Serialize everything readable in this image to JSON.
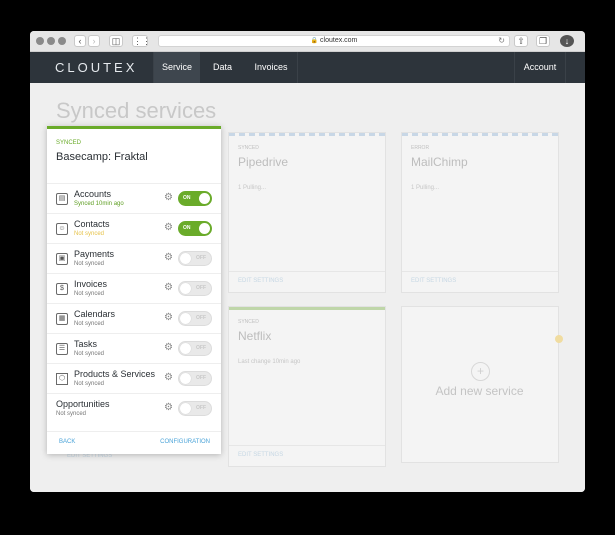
{
  "browser": {
    "url": "cloutex.com"
  },
  "nav": {
    "logo": "CLOUTEX",
    "items": [
      "Service",
      "Data",
      "Invoices"
    ],
    "account": "Account"
  },
  "page": {
    "title": "Synced services"
  },
  "cards": [
    {
      "status": "SYNCED",
      "name": "Pipedrive",
      "note": "1 Pulling...",
      "edit": "EDIT SETTINGS"
    },
    {
      "status": "ERROR",
      "name": "MailChimp",
      "note": "1 Pulling...",
      "edit": "EDIT SETTINGS"
    },
    {
      "status": "SYNCED",
      "name": "Netflix",
      "note": "Last change 10min ago",
      "edit": "EDIT SETTINGS"
    },
    {
      "add_label": "Add new service"
    }
  ],
  "hidden_card_edit": "EDIT SETTINGS",
  "panel": {
    "status": "SYNCED",
    "title": "Basecamp: Fraktal",
    "rows": [
      {
        "label": "Accounts",
        "sub": "Synced 10min ago",
        "toggle": "ON",
        "icon": "accounts-icon"
      },
      {
        "label": "Contacts",
        "sub": "Not synced",
        "toggle": "ON",
        "icon": "contacts-icon"
      },
      {
        "label": "Payments",
        "sub": "Not synced",
        "toggle": "OFF",
        "icon": "wallet-icon"
      },
      {
        "label": "Invoices",
        "sub": "Not synced",
        "toggle": "OFF",
        "icon": "invoice-icon"
      },
      {
        "label": "Calendars",
        "sub": "Not synced",
        "toggle": "OFF",
        "icon": "calendar-icon"
      },
      {
        "label": "Tasks",
        "sub": "Not synced",
        "toggle": "OFF",
        "icon": "tasks-icon"
      },
      {
        "label": "Products & Services",
        "sub": "Not synced",
        "toggle": "OFF",
        "icon": "box-icon"
      },
      {
        "label": "Opportunities",
        "sub": "Not synced",
        "toggle": "OFF"
      }
    ],
    "back": "BACK",
    "configuration": "CONFIGURATION"
  },
  "colors": {
    "accent_green": "#6aab2a",
    "nav_bg": "#2d343b",
    "link_blue": "#4aa3d8",
    "warning_yellow": "#e6c34a"
  }
}
